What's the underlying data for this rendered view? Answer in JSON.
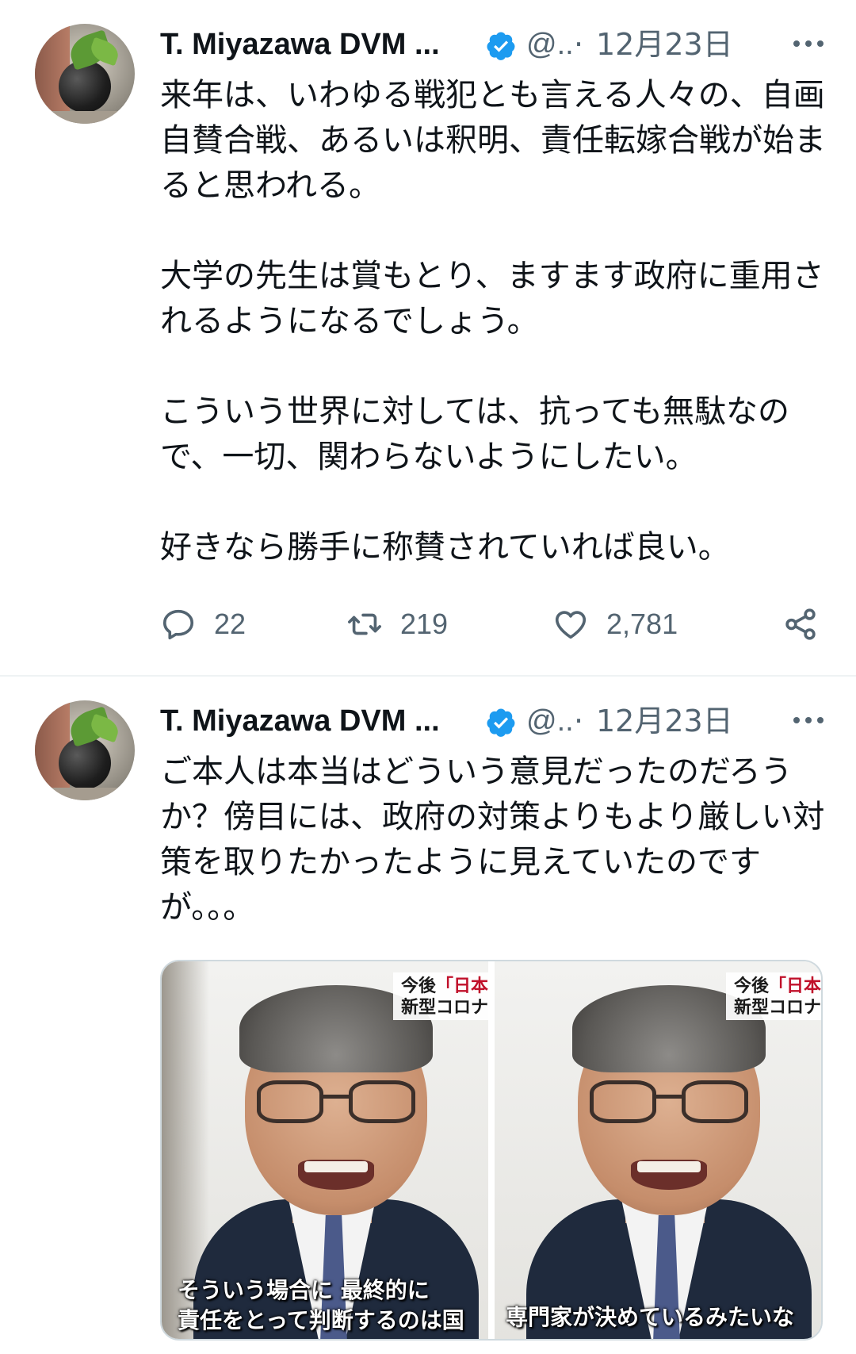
{
  "tweets": [
    {
      "display_name": "T. Miyazawa DVM ...",
      "handle": "@..",
      "separator": "·",
      "date": "12月23日",
      "paragraphs": [
        "来年は、いわゆる戦犯とも言える人々の、自画自賛合戦、あるいは釈明、責任転嫁合戦が始まると思われる。",
        "大学の先生は賞もとり、ますます政府に重用されるようになるでしょう。",
        "こういう世界に対しては、抗っても無駄なので、一切、関わらないようにしたい。",
        "好きなら勝手に称賛されていれば良い。"
      ],
      "actions": {
        "reply_count": "22",
        "retweet_count": "219",
        "like_count": "2,781"
      }
    },
    {
      "display_name": "T. Miyazawa DVM ...",
      "handle": "@..",
      "separator": "·",
      "date": "12月23日",
      "paragraphs": [
        "ご本人は本当はどういう意見だったのだろうか？傍目には、政府の対策よりもより厳しい対策を取りたかったように見えていたのですが。。。"
      ],
      "media": [
        {
          "caption_line1_prefix": "今後",
          "caption_line1_red": "「日本",
          "caption_line2": "新型コロナ",
          "subtitle_line1": "そういう場合に 最終的に",
          "subtitle_line2": "責任をとって判断するのは国"
        },
        {
          "caption_line1_prefix": "今後",
          "caption_line1_red": "「日本",
          "caption_line2": "新型コロナ",
          "subtitle_line1": "専門家が決めているみたいな"
        }
      ]
    }
  ],
  "icons": {
    "verified": "verified-badge-icon",
    "more": "more-options-icon",
    "reply": "reply-icon",
    "retweet": "retweet-icon",
    "like": "like-icon",
    "share": "share-icon"
  },
  "colors": {
    "text_primary": "#0f1419",
    "text_secondary": "#536471",
    "verified_blue": "#1d9bf0",
    "divider": "#eff3f4",
    "caption_red": "#c0102a"
  }
}
